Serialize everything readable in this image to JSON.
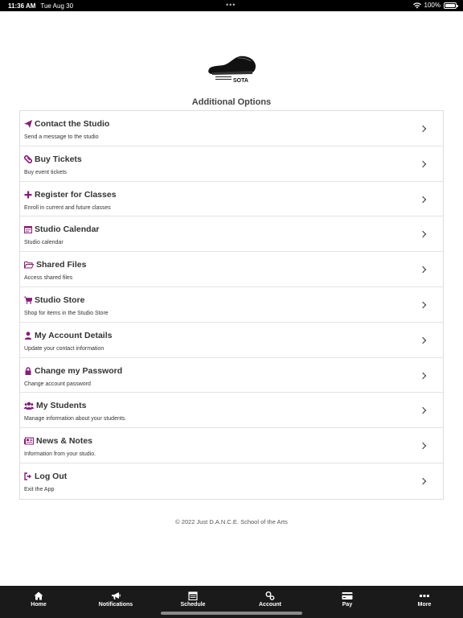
{
  "status_bar": {
    "time": "11:36 AM",
    "date": "Tue Aug 30",
    "battery": "100%"
  },
  "logo": {
    "text": "SOTA",
    "icon": "dance-shoe-icon"
  },
  "page": {
    "title": "Additional Options"
  },
  "options": [
    {
      "icon": "paper-plane-icon",
      "label": "Contact the Studio",
      "sub": "Send a message to the studio"
    },
    {
      "icon": "ticket-icon",
      "label": "Buy Tickets",
      "sub": "Buy event tickets"
    },
    {
      "icon": "plus-icon",
      "label": "Register for Classes",
      "sub": "Enroll in current and future classes"
    },
    {
      "icon": "calendar-icon",
      "label": "Studio Calendar",
      "sub": "Studio calendar"
    },
    {
      "icon": "folder-icon",
      "label": "Shared Files",
      "sub": "Access shared files"
    },
    {
      "icon": "cart-icon",
      "label": "Studio Store",
      "sub": "Shop for items in the Studio Store"
    },
    {
      "icon": "user-icon",
      "label": "My Account Details",
      "sub": "Update your contact information"
    },
    {
      "icon": "lock-icon",
      "label": "Change my Password",
      "sub": "Change account password"
    },
    {
      "icon": "users-icon",
      "label": "My Students",
      "sub": "Manage information about your students."
    },
    {
      "icon": "newspaper-icon",
      "label": "News & Notes",
      "sub": "Information from your studio."
    },
    {
      "icon": "sign-out-icon",
      "label": "Log Out",
      "sub": "Exit the App"
    }
  ],
  "footer": {
    "copyright": "© 2022 Just D.A.N.C.E. School of the Arts"
  },
  "tabs": [
    {
      "label": "Home",
      "icon": "home-icon"
    },
    {
      "label": "Notifications",
      "icon": "megaphone-icon"
    },
    {
      "label": "Schedule",
      "icon": "schedule-icon"
    },
    {
      "label": "Account",
      "icon": "account-cog-icon"
    },
    {
      "label": "Pay",
      "icon": "credit-card-icon"
    },
    {
      "label": "More",
      "icon": "more-dots-icon"
    }
  ],
  "colors": {
    "accent": "#8a1a7a",
    "tabbar": "#1a1a1a"
  }
}
